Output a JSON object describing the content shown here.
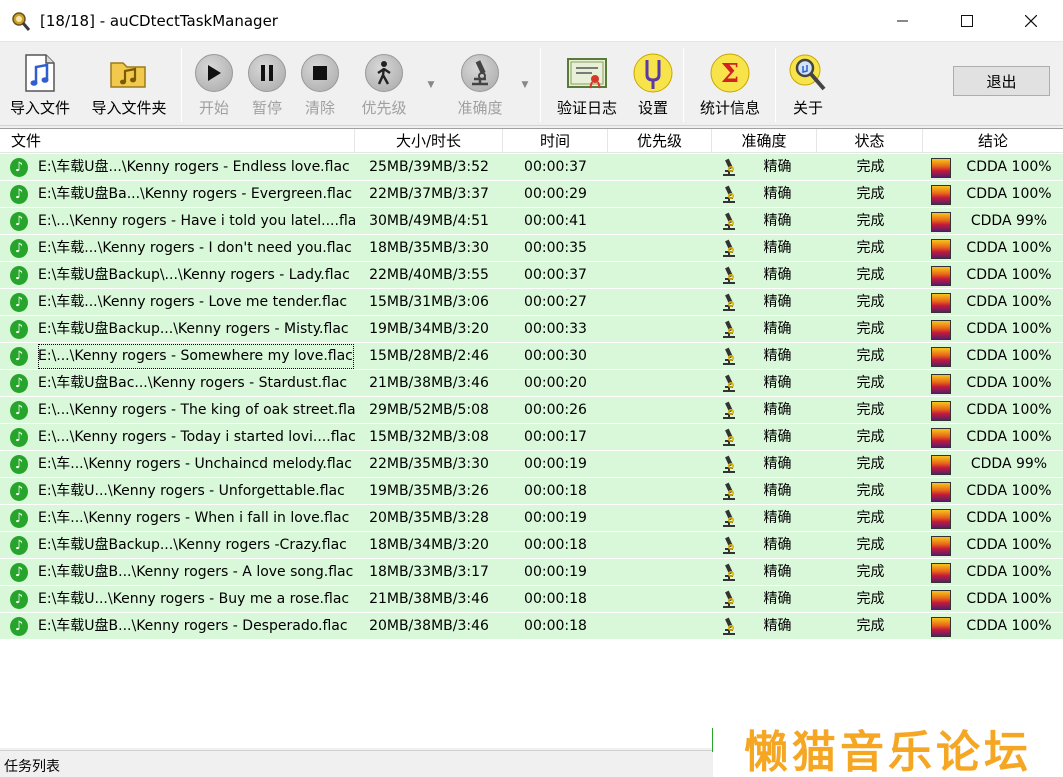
{
  "window": {
    "title": "[18/18] - auCDtectTaskManager",
    "min_icon": "minimize-icon",
    "max_icon": "maximize-icon",
    "close_icon": "close-icon"
  },
  "toolbar": {
    "import_file": "导入文件",
    "import_folder": "导入文件夹",
    "start": "开始",
    "pause": "暂停",
    "clear": "清除",
    "priority": "优先级",
    "accuracy": "准确度",
    "verify_log": "验证日志",
    "settings": "设置",
    "statistics": "统计信息",
    "about": "关于",
    "exit": "退出"
  },
  "columns": {
    "file": "文件",
    "size": "大小/时长",
    "time": "时间",
    "priority": "优先级",
    "accuracy": "准确度",
    "status": "状态",
    "result": "结论"
  },
  "rows": [
    {
      "file": "E:\\车载U盘...\\Kenny rogers - Endless love.flac",
      "size": "25MB/39MB/3:52",
      "time": "00:00:37",
      "priority": "",
      "accuracy": "精确",
      "status": "完成",
      "result": "CDDA 100%"
    },
    {
      "file": "E:\\车载U盘Ba...\\Kenny rogers - Evergreen.flac",
      "size": "22MB/37MB/3:37",
      "time": "00:00:29",
      "priority": "",
      "accuracy": "精确",
      "status": "完成",
      "result": "CDDA 100%"
    },
    {
      "file": "E:\\...\\Kenny rogers - Have i told you latel....flac",
      "size": "30MB/49MB/4:51",
      "time": "00:00:41",
      "priority": "",
      "accuracy": "精确",
      "status": "完成",
      "result": "CDDA 99%"
    },
    {
      "file": "E:\\车载...\\Kenny rogers - I don't need you.flac",
      "size": "18MB/35MB/3:30",
      "time": "00:00:35",
      "priority": "",
      "accuracy": "精确",
      "status": "完成",
      "result": "CDDA 100%"
    },
    {
      "file": "E:\\车载U盘Backup\\...\\Kenny rogers - Lady.flac",
      "size": "22MB/40MB/3:55",
      "time": "00:00:37",
      "priority": "",
      "accuracy": "精确",
      "status": "完成",
      "result": "CDDA 100%"
    },
    {
      "file": "E:\\车载...\\Kenny rogers - Love me tender.flac",
      "size": "15MB/31MB/3:06",
      "time": "00:00:27",
      "priority": "",
      "accuracy": "精确",
      "status": "完成",
      "result": "CDDA 100%"
    },
    {
      "file": "E:\\车载U盘Backup...\\Kenny rogers - Misty.flac",
      "size": "19MB/34MB/3:20",
      "time": "00:00:33",
      "priority": "",
      "accuracy": "精确",
      "status": "完成",
      "result": "CDDA 100%"
    },
    {
      "file": "E:\\...\\Kenny rogers - Somewhere my love.flac",
      "size": "15MB/28MB/2:46",
      "time": "00:00:30",
      "priority": "",
      "accuracy": "精确",
      "status": "完成",
      "result": "CDDA 100%"
    },
    {
      "file": "E:\\车载U盘Bac...\\Kenny rogers - Stardust.flac",
      "size": "21MB/38MB/3:46",
      "time": "00:00:20",
      "priority": "",
      "accuracy": "精确",
      "status": "完成",
      "result": "CDDA 100%"
    },
    {
      "file": "E:\\...\\Kenny rogers - The king of oak street.flac",
      "size": "29MB/52MB/5:08",
      "time": "00:00:26",
      "priority": "",
      "accuracy": "精确",
      "status": "完成",
      "result": "CDDA 100%"
    },
    {
      "file": "E:\\...\\Kenny rogers - Today i started lovi....flac",
      "size": "15MB/32MB/3:08",
      "time": "00:00:17",
      "priority": "",
      "accuracy": "精确",
      "status": "完成",
      "result": "CDDA 100%"
    },
    {
      "file": "E:\\车...\\Kenny rogers - Unchaincd melody.flac",
      "size": "22MB/35MB/3:30",
      "time": "00:00:19",
      "priority": "",
      "accuracy": "精确",
      "status": "完成",
      "result": "CDDA 99%"
    },
    {
      "file": "E:\\车载U...\\Kenny rogers - Unforgettable.flac",
      "size": "19MB/35MB/3:26",
      "time": "00:00:18",
      "priority": "",
      "accuracy": "精确",
      "status": "完成",
      "result": "CDDA 100%"
    },
    {
      "file": "E:\\车...\\Kenny rogers - When i fall in love.flac",
      "size": "20MB/35MB/3:28",
      "time": "00:00:19",
      "priority": "",
      "accuracy": "精确",
      "status": "完成",
      "result": "CDDA 100%"
    },
    {
      "file": "E:\\车载U盘Backup...\\Kenny rogers -Crazy.flac",
      "size": "18MB/34MB/3:20",
      "time": "00:00:18",
      "priority": "",
      "accuracy": "精确",
      "status": "完成",
      "result": "CDDA 100%"
    },
    {
      "file": "E:\\车载U盘B...\\Kenny rogers - A love song.flac",
      "size": "18MB/33MB/3:17",
      "time": "00:00:19",
      "priority": "",
      "accuracy": "精确",
      "status": "完成",
      "result": "CDDA 100%"
    },
    {
      "file": "E:\\车载U...\\Kenny rogers - Buy me a  rose.flac",
      "size": "21MB/38MB/3:46",
      "time": "00:00:18",
      "priority": "",
      "accuracy": "精确",
      "status": "完成",
      "result": "CDDA 100%"
    },
    {
      "file": "E:\\车载U盘B...\\Kenny rogers - Desperado.flac",
      "size": "20MB/38MB/3:46",
      "time": "00:00:18",
      "priority": "",
      "accuracy": "精确",
      "status": "完成",
      "result": "CDDA 100%"
    }
  ],
  "focused_row": 7,
  "statusbar": {
    "text": "任务列表"
  },
  "watermark": {
    "text": "懒猫音乐论坛"
  },
  "colors": {
    "row_bg": "#d9f7d9",
    "accent_green": "#27a42b",
    "watermark": "#f5a623"
  }
}
